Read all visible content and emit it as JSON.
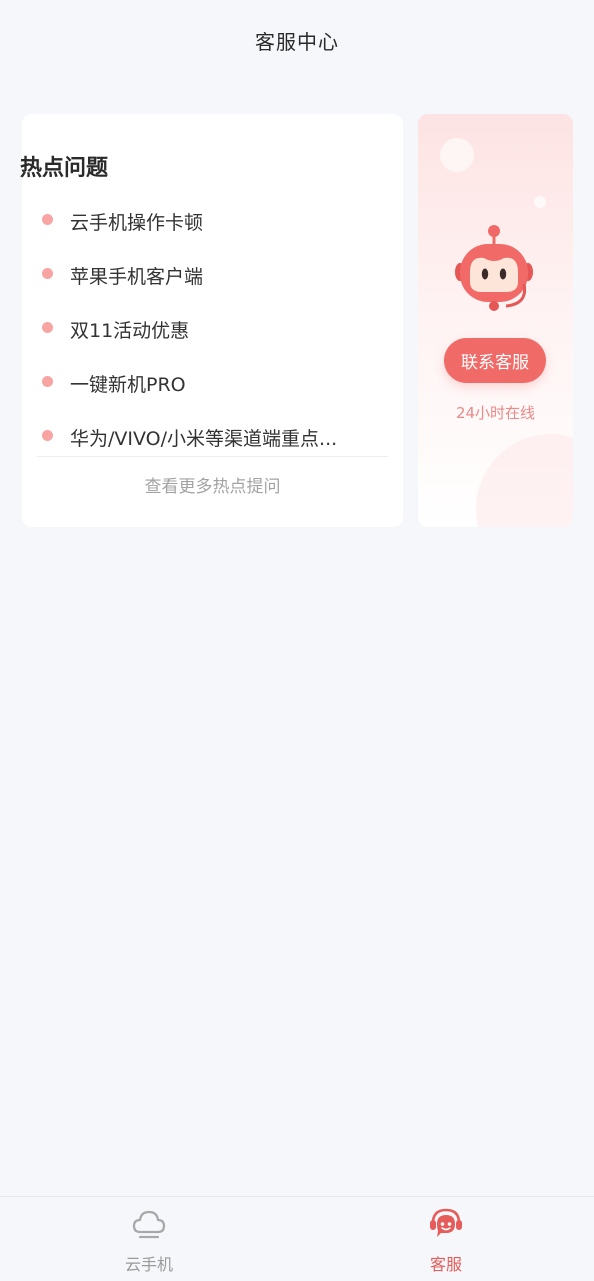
{
  "header": {
    "title": "客服中心"
  },
  "faq": {
    "title": "热点问题",
    "items": [
      "云手机操作卡顿",
      "苹果手机客户端",
      "双11活动优惠",
      "一键新机PRO",
      "华为/VIVO/小米等渠道端重点..."
    ],
    "more_label": "查看更多热点提问",
    "dot_color": "#f7a4a3"
  },
  "service": {
    "contact_button_label": "联系客服",
    "online_text": "24小时在线",
    "accent_color": "#f06a68",
    "icon": "robot-mascot-icon"
  },
  "tabbar": {
    "tabs": [
      {
        "label": "云手机",
        "icon": "cloud-icon",
        "active": false,
        "color": "#9a9a9a"
      },
      {
        "label": "客服",
        "icon": "headset-chat-icon",
        "active": true,
        "color": "#e55c5a"
      }
    ]
  }
}
